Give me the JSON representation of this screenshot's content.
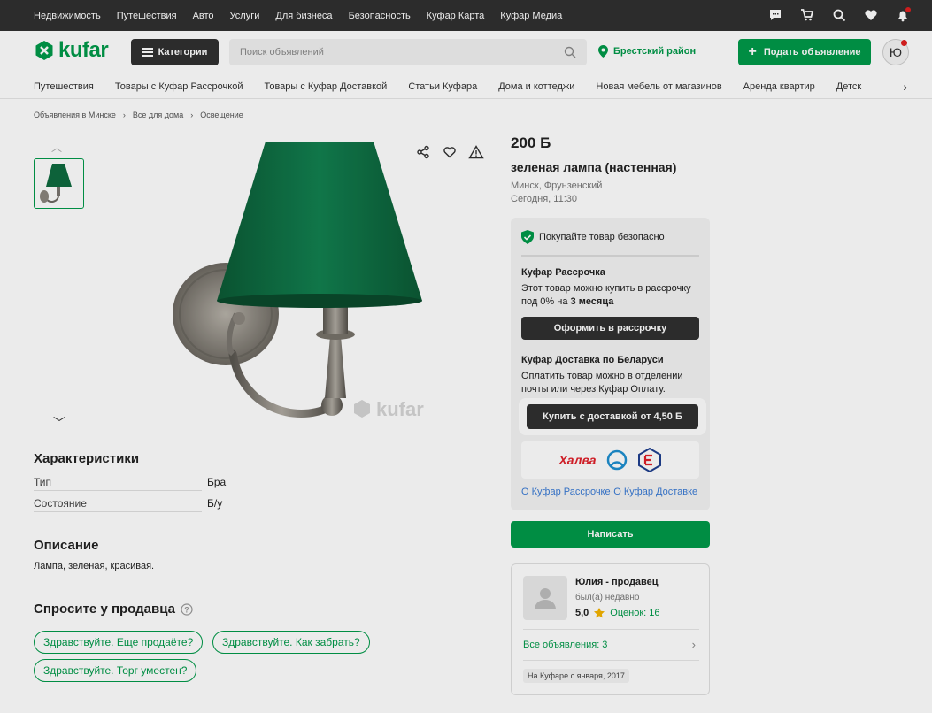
{
  "topbar": {
    "links": [
      "Недвижимость",
      "Путешествия",
      "Авто",
      "Услуги",
      "Для бизнеса",
      "Безопасность",
      "Куфар Карта",
      "Куфар Медиа"
    ],
    "icons": [
      "chat-icon",
      "cart-icon",
      "search-saved-icon",
      "heart-icon",
      "bell-icon"
    ]
  },
  "header": {
    "logo_text": "kufar",
    "categories_label": "Категории",
    "search_placeholder": "Поиск объявлений",
    "region": "Брестский район",
    "post_label": "Подать объявление",
    "avatar_letter": "Ю"
  },
  "subnav": [
    "Путешествия",
    "Товары с Куфар Рассрочкой",
    "Товары с Куфар Доставкой",
    "Статьи Куфара",
    "Дома и коттеджи",
    "Новая мебель от магазинов",
    "Аренда квартир",
    "Детск"
  ],
  "breadcrumbs": [
    "Объявления в Минске",
    "›",
    "Все для дома",
    "›",
    "Освещение"
  ],
  "watermark": "kufar",
  "characteristics": {
    "title": "Характеристики",
    "rows": [
      {
        "key": "Тип",
        "value": "Бра"
      },
      {
        "key": "Состояние",
        "value": "Б/у"
      }
    ]
  },
  "description": {
    "title": "Описание",
    "text": "Лампа, зеленая, красивая."
  },
  "ask": {
    "title": "Спросите у продавца",
    "chips": [
      "Здравствуйте. Еще продаёте?",
      "Здравствуйте. Как забрать?",
      "Здравствуйте. Торг уместен?"
    ]
  },
  "listing": {
    "price": "200 Б",
    "title": "зеленая лампа (настенная)",
    "location": "Минск, Фрунзенский",
    "date": "Сегодня, 11:30"
  },
  "panel": {
    "safe_text": "Покупайте товар безопасно",
    "installment_title": "Куфар Рассрочка",
    "installment_text_1": "Этот товар можно купить в рассрочку",
    "installment_text_2": "под 0% на ",
    "installment_bold": "3 месяца",
    "installment_btn": "Оформить в рассрочку",
    "delivery_title": "Куфар Доставка по Беларуси",
    "delivery_text_1": "Оплатить товар можно в отделении",
    "delivery_text_2": "почты или через Куфар Оплату.",
    "delivery_btn": "Купить с доставкой от 4,50 Б",
    "pay_halva": "Халва",
    "links": "О Куфар Рассрочке·О Куфар Доставке"
  },
  "write_btn": "Написать",
  "seller": {
    "name": "Юлия - продавец",
    "status": "был(а) недавно",
    "rating": "5,0",
    "reviews": "Оценок: 16",
    "all_ads": "Все объявления: 3",
    "since": "На Куфаре с января, 2017"
  },
  "colors": {
    "brand": "#009a49",
    "dark": "#303030"
  }
}
